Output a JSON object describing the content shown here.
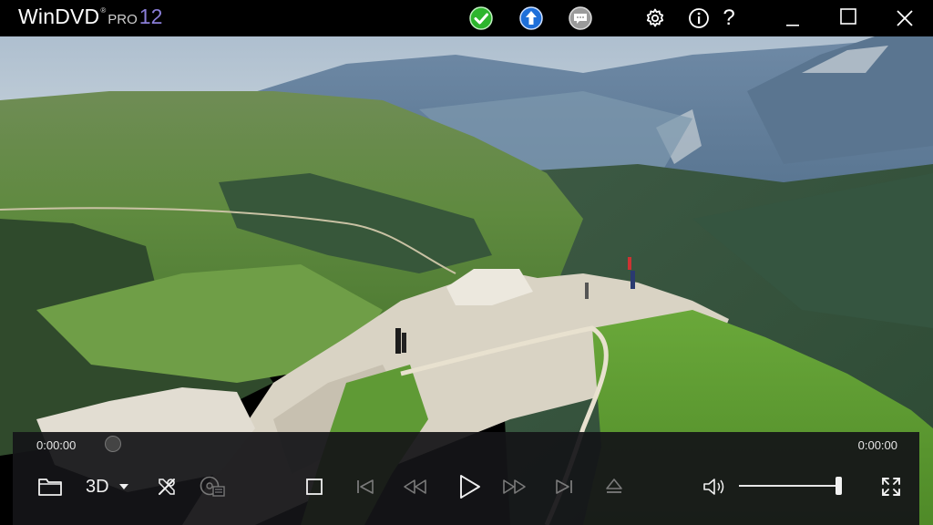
{
  "app": {
    "brand_name": "WinDVD",
    "brand_reg": "®",
    "brand_edition": "PRO",
    "brand_version": "12"
  },
  "titlebar": {
    "icons": [
      "check-status-icon",
      "upgrade-icon",
      "feedback-icon",
      "settings-icon",
      "info-icon",
      "help-icon",
      "minimize-icon",
      "maximize-icon",
      "close-icon"
    ],
    "help_label": "?"
  },
  "playback": {
    "current_time": "0:00:00",
    "total_time": "0:00:00",
    "progress": 0,
    "volume": 1.0
  },
  "controls": {
    "mode_3d_label": "3D"
  },
  "colors": {
    "accent_purple": "#8a7ed8",
    "status_green": "#2db52d",
    "upgrade_blue": "#1e6fd9",
    "panel_bg": "#141418"
  }
}
